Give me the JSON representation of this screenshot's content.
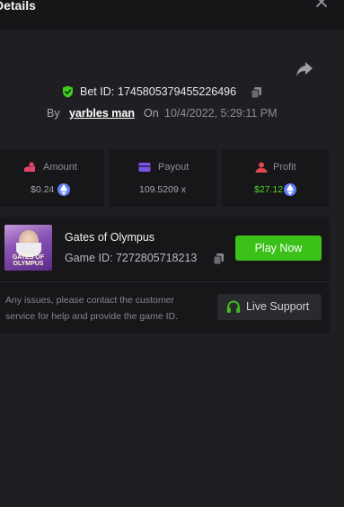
{
  "header": {
    "title": "Details"
  },
  "bet": {
    "id_label": "Bet ID:",
    "id_value": "1745805379455226496",
    "by_label": "By",
    "username": "yarbles man",
    "on_label": "On",
    "datetime": "10/4/2022, 5:29:11 PM"
  },
  "stats": {
    "amount": {
      "label": "Amount",
      "value": "$0.24"
    },
    "payout": {
      "label": "Payout",
      "value": "109.5209 x"
    },
    "profit": {
      "label": "Profit",
      "value": "$27.12"
    }
  },
  "game": {
    "name": "Gates of Olympus",
    "id_text": "Game ID: 7272805718213",
    "thumb_text_1": "GATES OF",
    "thumb_text_2": "OLYMPUS",
    "play_label": "Play Now"
  },
  "support": {
    "text": "Any issues, please contact the customer service for help and provide the game ID.",
    "button_label": "Live Support"
  },
  "colors": {
    "accent_green": "#3bc117",
    "profit_green": "#4fd425",
    "shield_green": "#3ecf1a",
    "amount_icon": "#e0466b",
    "payout_icon": "#7a55e6",
    "profit_icon": "#e0484f",
    "eth_blue": "#5f7ff5"
  },
  "icons": {
    "close": "close-icon",
    "share": "share-icon",
    "shield": "shield-check-icon",
    "copy": "copy-icon",
    "amount": "coins-icon",
    "payout": "wallet-icon",
    "profit": "user-profit-icon",
    "currency": "eth-coin-icon",
    "support": "headset-icon"
  }
}
